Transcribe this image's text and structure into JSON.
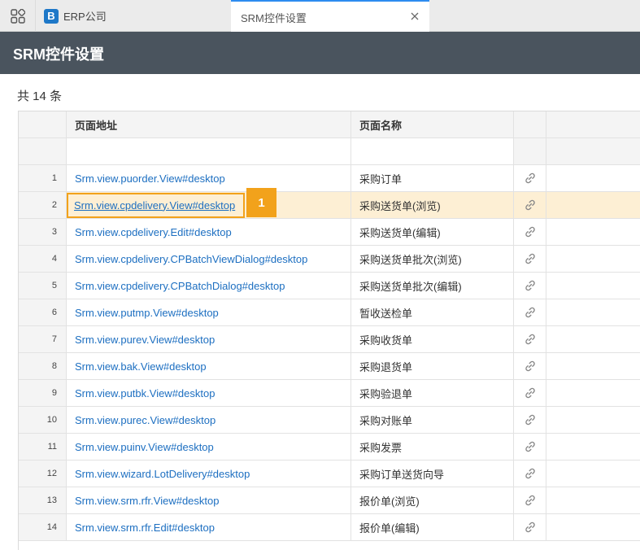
{
  "tabs": {
    "erp_label": "ERP公司",
    "srm_label": "SRM控件设置"
  },
  "header": {
    "title": "SRM控件设置"
  },
  "summary": {
    "count_text": "共 14 条"
  },
  "table": {
    "columns": {
      "url": "页面地址",
      "name": "页面名称"
    },
    "rows": [
      {
        "num": "1",
        "url": "Srm.view.puorder.View#desktop",
        "name": "采购订单"
      },
      {
        "num": "2",
        "url": "Srm.view.cpdelivery.View#desktop",
        "name": "采购送货单(浏览)"
      },
      {
        "num": "3",
        "url": "Srm.view.cpdelivery.Edit#desktop",
        "name": "采购送货单(编辑)"
      },
      {
        "num": "4",
        "url": "Srm.view.cpdelivery.CPBatchViewDialog#desktop",
        "name": "采购送货单批次(浏览)"
      },
      {
        "num": "5",
        "url": "Srm.view.cpdelivery.CPBatchDialog#desktop",
        "name": "采购送货单批次(编辑)"
      },
      {
        "num": "6",
        "url": "Srm.view.putmp.View#desktop",
        "name": "暂收送检单"
      },
      {
        "num": "7",
        "url": "Srm.view.purev.View#desktop",
        "name": "采购收货单"
      },
      {
        "num": "8",
        "url": "Srm.view.bak.View#desktop",
        "name": "采购退货单"
      },
      {
        "num": "9",
        "url": "Srm.view.putbk.View#desktop",
        "name": "采购验退单"
      },
      {
        "num": "10",
        "url": "Srm.view.purec.View#desktop",
        "name": "采购对账单"
      },
      {
        "num": "11",
        "url": "Srm.view.puinv.View#desktop",
        "name": "采购发票"
      },
      {
        "num": "12",
        "url": "Srm.view.wizard.LotDelivery#desktop",
        "name": "采购订单送货向导"
      },
      {
        "num": "13",
        "url": "Srm.view.srm.rfr.View#desktop",
        "name": "报价单(浏览)"
      },
      {
        "num": "14",
        "url": "Srm.view.srm.rfr.Edit#desktop",
        "name": "报价单(编辑)"
      }
    ],
    "selected_row": "2"
  },
  "annotation": {
    "badge_label": "1"
  },
  "icons": {
    "row_action": "link-icon",
    "apps": "grid-apps-icon",
    "close": "close-icon"
  },
  "colors": {
    "header_bg": "#4a545e",
    "link": "#1d6fc1",
    "highlight": "#f2a21b",
    "selected_row": "#fdefd4"
  }
}
